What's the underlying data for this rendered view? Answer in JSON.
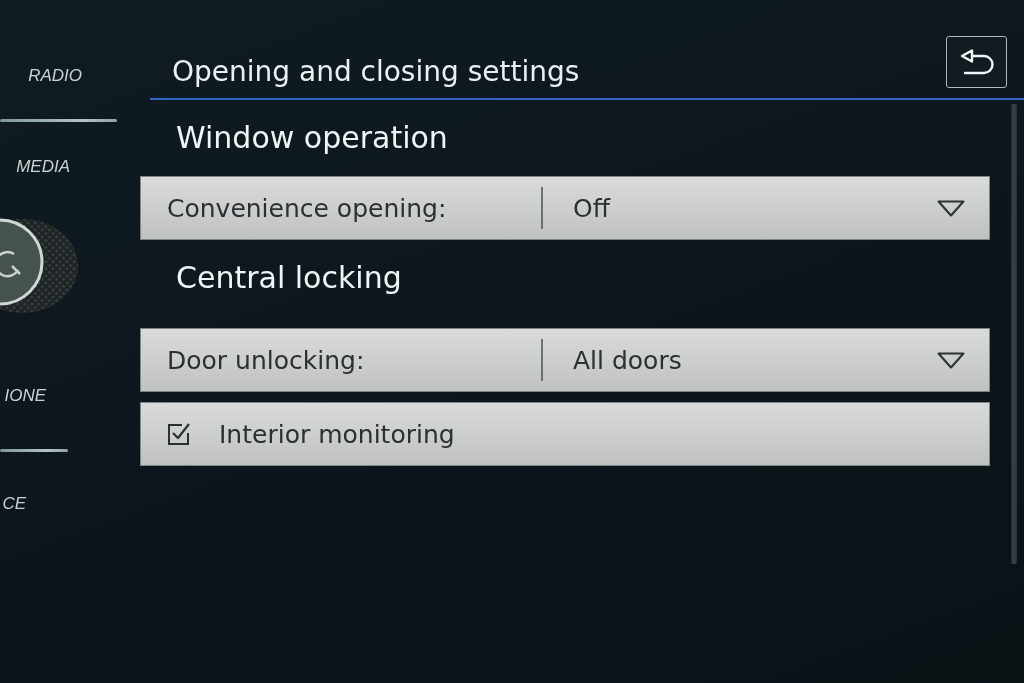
{
  "sidebar": {
    "items": [
      {
        "label": "RADIO"
      },
      {
        "label": "MEDIA"
      },
      {
        "label": "IONE"
      },
      {
        "label": "CE"
      }
    ]
  },
  "header": {
    "title": "Opening and closing settings"
  },
  "sections": [
    {
      "heading": "Window operation",
      "rows": [
        {
          "kind": "dropdown",
          "label": "Convenience opening:",
          "value": "Off"
        }
      ]
    },
    {
      "heading": "Central locking",
      "rows": [
        {
          "kind": "dropdown",
          "label": "Door unlocking:",
          "value": "All doors"
        },
        {
          "kind": "checkbox",
          "label": "Interior monitoring",
          "checked": true
        }
      ]
    }
  ]
}
